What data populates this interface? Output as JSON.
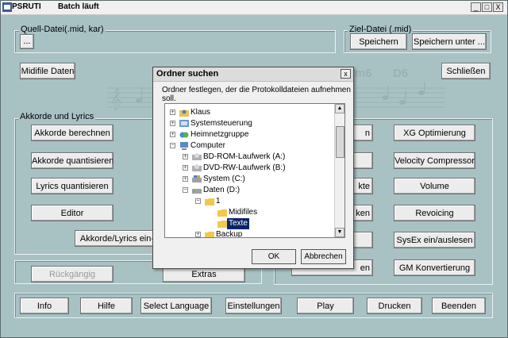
{
  "titlebar": {
    "app_name": "PSRUTI",
    "status": "Batch läuft",
    "minimize": "_",
    "maximize": "□",
    "close": "X"
  },
  "source": {
    "group_label": "Quell-Datei(.mid, kar)",
    "browse_label": "..."
  },
  "target": {
    "group_label": "Ziel-Datei (.mid)",
    "save_label": "Speichern",
    "save_as_label": "Speichern unter ..."
  },
  "midifile_label": "Midifile Daten",
  "close_label": "Schließen",
  "staff_chords": {
    "c1": "m6",
    "c2": "D6"
  },
  "chords": {
    "group_label": "Akkorde und Lyrics",
    "calc_label": "Akkorde berechnen",
    "quantize_label": "Akkorde quantisieren",
    "lyrics_label": "Lyrics quantisieren",
    "editor_label": "Editor",
    "io_label": "Akkorde/Lyrics ein-/"
  },
  "partial_buttons": {
    "b1": "n",
    "b2": "kte",
    "b3": "ken",
    "b4": "en"
  },
  "right_buttons": {
    "xg": "XG Optimierung",
    "velocity": "Velocity Compressor",
    "volume": "Volume",
    "revoicing": "Revoicing",
    "sysex": "SysEx ein/auslesen",
    "gm": "GM Konvertierung"
  },
  "undo_label": "Rückgängig",
  "extras_label": "Extras",
  "bottom": {
    "info": "Info",
    "help": "Hilfe",
    "language": "Select Language",
    "settings": "Einstellungen",
    "play": "Play",
    "print": "Drucken",
    "quit": "Beenden"
  },
  "dialog": {
    "title": "Ordner suchen",
    "close": "x",
    "description": "Ordner festlegen, der die Protokolldateien aufnehmen soll.",
    "ok_label": "OK",
    "cancel_label": "Abbrechen",
    "tree": {
      "klaus": "Klaus",
      "system_control": "Systemsteuerung",
      "homegroup": "Heimnetzgruppe",
      "computer": "Computer",
      "bd_drive": "BD-ROM-Laufwerk (A:)",
      "dvd_drive": "DVD-RW-Laufwerk (B:)",
      "system_drive": "System (C:)",
      "data_drive": "Daten (D:)",
      "folder_1": "1",
      "midifiles": "Midifiles",
      "texte": "Texte",
      "backup": "Backup"
    }
  }
}
